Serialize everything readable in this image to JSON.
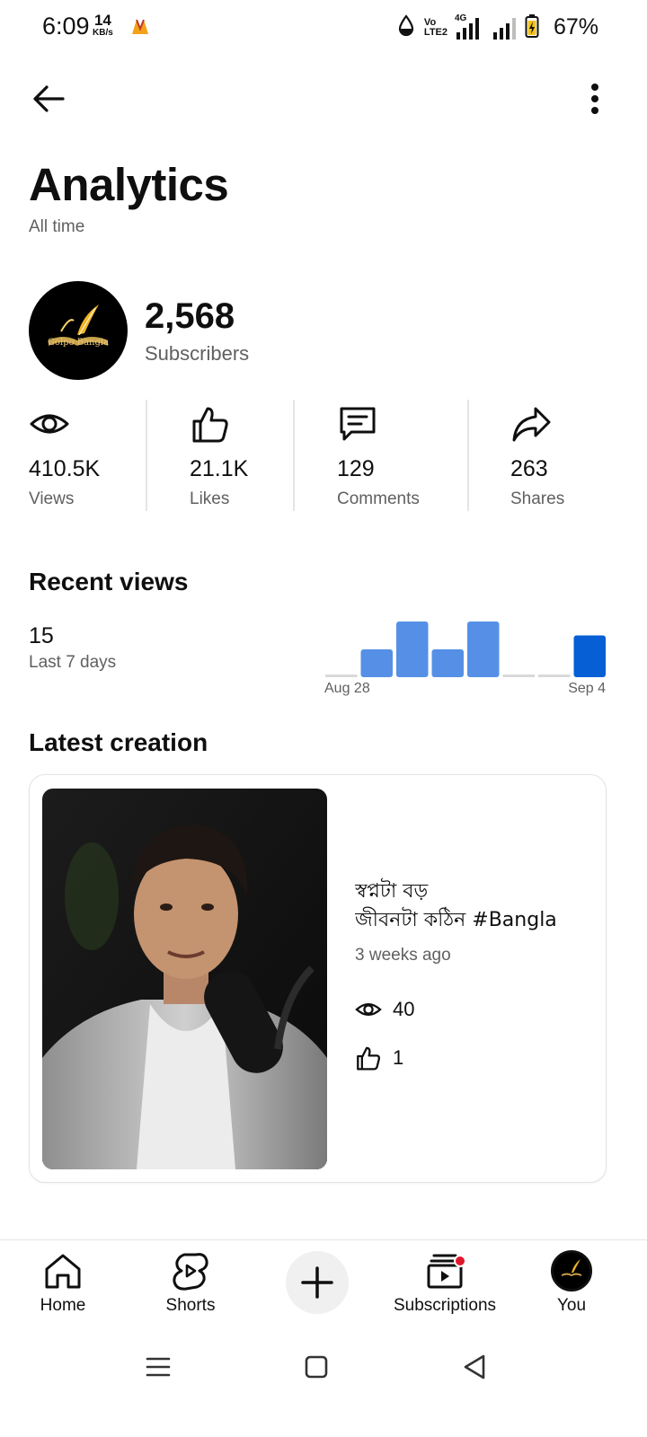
{
  "status_bar": {
    "time": "6:09",
    "net_speed_value": "14",
    "net_speed_unit": "KB/s",
    "battery_percent": "67%",
    "icons": [
      "app-notification-icon",
      "data-saver-icon",
      "volte-icon",
      "4g-signal-icon",
      "signal-icon",
      "battery-charging-icon"
    ],
    "volte_text_top": "Vo",
    "volte_text_bottom": "LTE2",
    "network_type": "4G"
  },
  "header": {
    "back_icon": "arrow-left-icon",
    "more_icon": "more-vert-icon",
    "title": "Analytics",
    "period": "All time"
  },
  "channel": {
    "avatar_text": "Golpo Bangla",
    "subscriber_count": "2,568",
    "subscriber_label": "Subscribers"
  },
  "metrics": [
    {
      "icon": "eye-icon",
      "value": "410.5K",
      "label": "Views"
    },
    {
      "icon": "thumbs-up-icon",
      "value": "21.1K",
      "label": "Likes"
    },
    {
      "icon": "comment-icon",
      "value": "129",
      "label": "Comments"
    },
    {
      "icon": "share-icon",
      "value": "263",
      "label": "Shares"
    }
  ],
  "recent_views": {
    "title": "Recent views",
    "count": "15",
    "period": "Last 7 days"
  },
  "chart_data": {
    "type": "bar",
    "categories": [
      "Aug 28",
      "Aug 29",
      "Aug 30",
      "Aug 31",
      "Sep 1",
      "Sep 2",
      "Sep 3",
      "Sep 4"
    ],
    "values": [
      0,
      2,
      4,
      2,
      4,
      0,
      0,
      3
    ],
    "x_tick_labels": [
      "Aug 28",
      "Sep 4"
    ],
    "ylim": [
      0,
      4
    ],
    "grid": false,
    "colors": {
      "bar": "#5590e6",
      "highlight": "#065fd4",
      "zero": "#d9d9d9"
    },
    "highlight_index": 7
  },
  "latest_creation": {
    "title": "Latest creation",
    "video_title_line1": "স্বপ্নটা বড়",
    "video_title_line2": "জীবনটা কঠিন  #Bangla",
    "age": "3 weeks ago",
    "views": "40",
    "likes": "1"
  },
  "bottom_nav": [
    {
      "icon": "home-icon",
      "label": "Home"
    },
    {
      "icon": "shorts-icon",
      "label": "Shorts"
    },
    {
      "icon": "plus-icon",
      "label": ""
    },
    {
      "icon": "subscriptions-icon",
      "label": "Subscriptions",
      "has_notification": true
    },
    {
      "icon": "avatar",
      "label": "You"
    }
  ],
  "system_nav": [
    "menu-icon",
    "home-square-icon",
    "back-triangle-icon"
  ],
  "colors": {
    "accent": "#065fd4",
    "text_primary": "#0f0f0f",
    "text_secondary": "#606060",
    "notification": "#e0182c"
  }
}
